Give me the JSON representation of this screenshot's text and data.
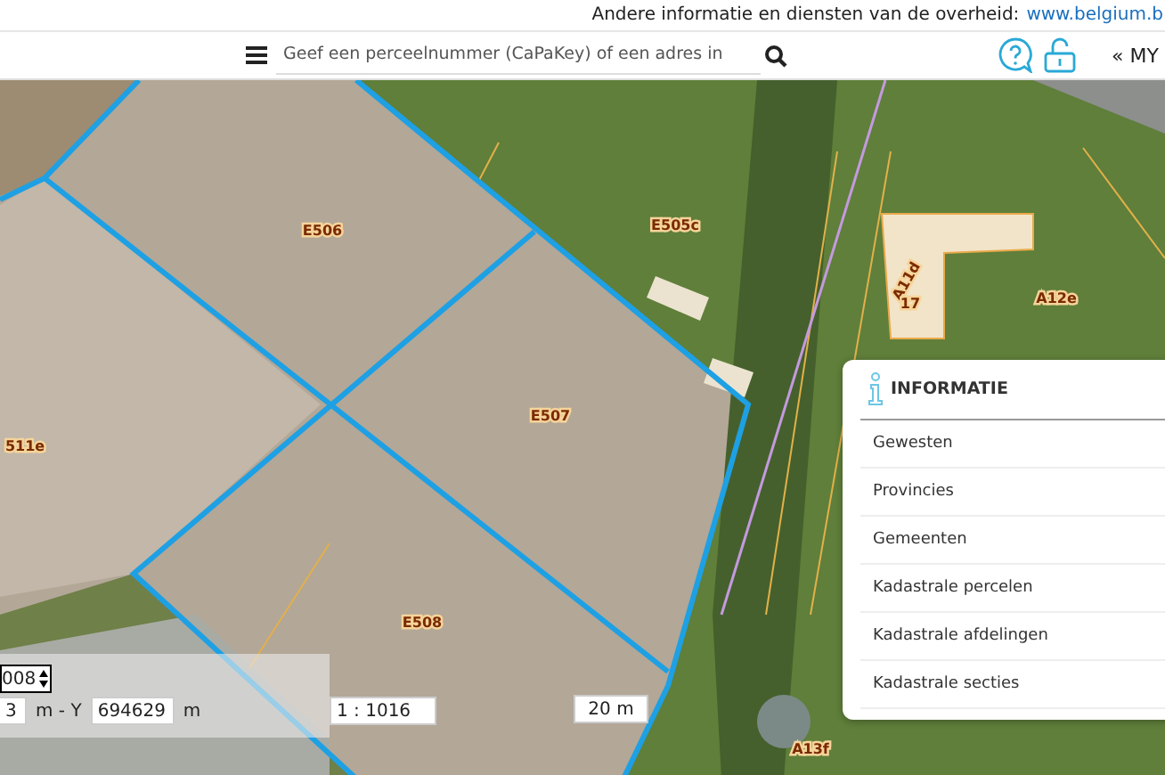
{
  "top_bar": {
    "text": "Andere informatie en diensten van de overheid:",
    "link": "www.belgium.b"
  },
  "header": {
    "search": {
      "placeholder": "Geef een perceelnummer (CaPaKey) of een adres in"
    },
    "account_link": "« MY"
  },
  "map": {
    "parcel_labels": [
      {
        "text": "E506"
      },
      {
        "text": "E505c"
      },
      {
        "text": "A11d"
      },
      {
        "text": "17"
      },
      {
        "text": "A12e"
      },
      {
        "text": "E507"
      },
      {
        "text": "511e"
      },
      {
        "text": "E508"
      },
      {
        "text": "A13f"
      }
    ]
  },
  "info_panel": {
    "title": "INFORMATIE",
    "items": [
      {
        "label": "Gewesten"
      },
      {
        "label": "Provincies"
      },
      {
        "label": "Gemeenten"
      },
      {
        "label": "Kadastrale percelen"
      },
      {
        "label": "Kadastrale afdelingen"
      },
      {
        "label": "Kadastrale secties"
      }
    ]
  },
  "coordinates": {
    "spinner_value": "008",
    "x_value": "3",
    "separator": "m - Y",
    "y_value": "694629",
    "unit": "m"
  },
  "scale": {
    "ratio": "1 : 1016",
    "bar_label": "20 m"
  }
}
